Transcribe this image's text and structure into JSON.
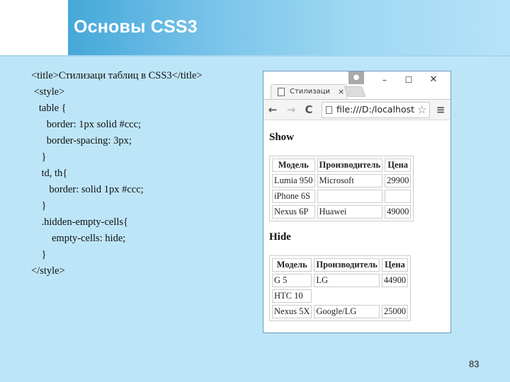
{
  "slide": {
    "title": "Основы CSS3",
    "number": "83"
  },
  "code": {
    "lines": [
      "<title>Стилизаци таблиц в CSS3</title>",
      " <style>",
      "   table {",
      "      border: 1px solid #ccc;",
      "      border-spacing: 3px;",
      "    }",
      "    td, th{",
      "       border: solid 1px #ccc;",
      "    }",
      "    .hidden-empty-cells{",
      "        empty-cells: hide;",
      "    }",
      "</style>"
    ]
  },
  "browser": {
    "tab_title": "Стилизаци",
    "tab_close": "×",
    "user_icon": "person-icon",
    "window_controls": {
      "minimize": "–",
      "maximize": "☐",
      "close": "✕"
    },
    "nav": {
      "back": "←",
      "forward": "→",
      "reload": "C",
      "menu": "≡"
    },
    "address": "file:///D:/localhost",
    "star": "☆",
    "page": {
      "show_heading": "Show",
      "hide_heading": "Hide",
      "headers": [
        "Модель",
        "Производитель",
        "Цена"
      ],
      "show_rows": [
        [
          "Lumia 950",
          "Microsoft",
          "29900"
        ],
        [
          "iPhone 6S",
          "",
          ""
        ],
        [
          "Nexus 6P",
          "Huawei",
          "49000"
        ]
      ],
      "hide_rows": [
        [
          "G 5",
          "LG",
          "44900"
        ],
        [
          "HTC 10",
          "",
          ""
        ],
        [
          "Nexus 5X",
          "Google/LG",
          "25000"
        ]
      ]
    }
  }
}
